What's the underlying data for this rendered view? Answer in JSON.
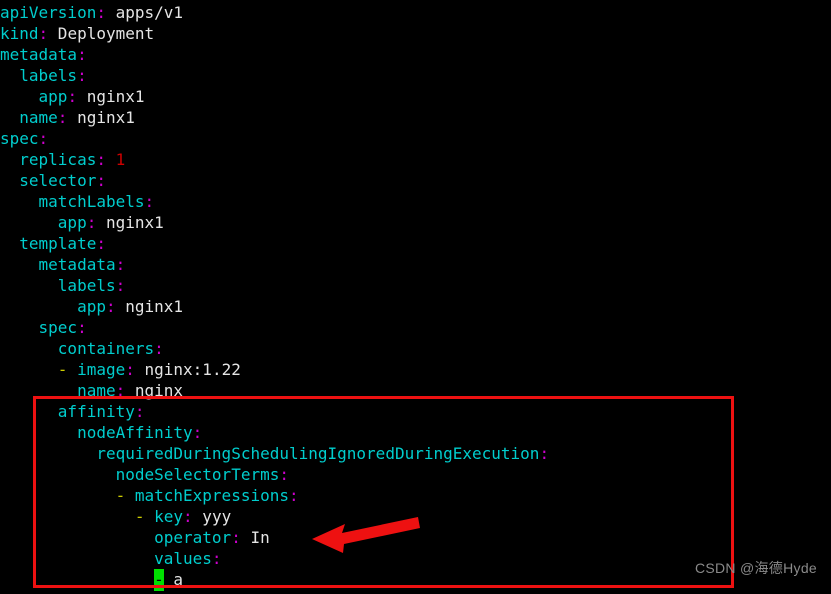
{
  "terminal": {
    "background_color": "#000000",
    "key_color": "#00cdcd",
    "colon_color": "#cd00cd",
    "value_color": "#e5e5e5",
    "number_color": "#cd0000",
    "dash_color": "#cdcd00",
    "cursor_color": "#00e000",
    "lines": [
      {
        "indent": "",
        "dash": "",
        "key": "apiVersion",
        "colon": ":",
        "value": " apps/v1",
        "value_type": "string"
      },
      {
        "indent": "",
        "dash": "",
        "key": "kind",
        "colon": ":",
        "value": " Deployment",
        "value_type": "string"
      },
      {
        "indent": "",
        "dash": "",
        "key": "metadata",
        "colon": ":",
        "value": "",
        "value_type": "none"
      },
      {
        "indent": "  ",
        "dash": "",
        "key": "labels",
        "colon": ":",
        "value": "",
        "value_type": "none"
      },
      {
        "indent": "    ",
        "dash": "",
        "key": "app",
        "colon": ":",
        "value": " nginx1",
        "value_type": "string"
      },
      {
        "indent": "  ",
        "dash": "",
        "key": "name",
        "colon": ":",
        "value": " nginx1",
        "value_type": "string"
      },
      {
        "indent": "",
        "dash": "",
        "key": "spec",
        "colon": ":",
        "value": "",
        "value_type": "none"
      },
      {
        "indent": "  ",
        "dash": "",
        "key": "replicas",
        "colon": ":",
        "value": " 1",
        "value_type": "number"
      },
      {
        "indent": "  ",
        "dash": "",
        "key": "selector",
        "colon": ":",
        "value": "",
        "value_type": "none"
      },
      {
        "indent": "    ",
        "dash": "",
        "key": "matchLabels",
        "colon": ":",
        "value": "",
        "value_type": "none"
      },
      {
        "indent": "      ",
        "dash": "",
        "key": "app",
        "colon": ":",
        "value": " nginx1",
        "value_type": "string"
      },
      {
        "indent": "  ",
        "dash": "",
        "key": "template",
        "colon": ":",
        "value": "",
        "value_type": "none"
      },
      {
        "indent": "    ",
        "dash": "",
        "key": "metadata",
        "colon": ":",
        "value": "",
        "value_type": "none"
      },
      {
        "indent": "      ",
        "dash": "",
        "key": "labels",
        "colon": ":",
        "value": "",
        "value_type": "none"
      },
      {
        "indent": "        ",
        "dash": "",
        "key": "app",
        "colon": ":",
        "value": " nginx1",
        "value_type": "string"
      },
      {
        "indent": "    ",
        "dash": "",
        "key": "spec",
        "colon": ":",
        "value": "",
        "value_type": "none"
      },
      {
        "indent": "      ",
        "dash": "",
        "key": "containers",
        "colon": ":",
        "value": "",
        "value_type": "none"
      },
      {
        "indent": "      ",
        "dash": "- ",
        "key": "image",
        "colon": ":",
        "value": " nginx:1.22",
        "value_type": "string"
      },
      {
        "indent": "        ",
        "dash": "",
        "key": "name",
        "colon": ":",
        "value": " nginx",
        "value_type": "string"
      },
      {
        "indent": "      ",
        "dash": "",
        "key": "affinity",
        "colon": ":",
        "value": "",
        "value_type": "none"
      },
      {
        "indent": "        ",
        "dash": "",
        "key": "nodeAffinity",
        "colon": ":",
        "value": "",
        "value_type": "none"
      },
      {
        "indent": "          ",
        "dash": "",
        "key": "requiredDuringSchedulingIgnoredDuringExecution",
        "colon": ":",
        "value": "",
        "value_type": "none"
      },
      {
        "indent": "            ",
        "dash": "",
        "key": "nodeSelectorTerms",
        "colon": ":",
        "value": "",
        "value_type": "none"
      },
      {
        "indent": "            ",
        "dash": "- ",
        "key": "matchExpressions",
        "colon": ":",
        "value": "",
        "value_type": "none"
      },
      {
        "indent": "              ",
        "dash": "- ",
        "key": "key",
        "colon": ":",
        "value": " yyy",
        "value_type": "string"
      },
      {
        "indent": "                ",
        "dash": "",
        "key": "operator",
        "colon": ":",
        "value": " In",
        "value_type": "string"
      },
      {
        "indent": "                ",
        "dash": "",
        "key": "values",
        "colon": ":",
        "value": "",
        "value_type": "none"
      },
      {
        "indent": "                ",
        "dash": "",
        "key": "",
        "colon": "",
        "value": "",
        "value_type": "cursor",
        "cursor_char": "-",
        "after_cursor": " a"
      }
    ]
  },
  "annotations": {
    "highlight_box": {
      "label": "affinity-block-highlight",
      "color": "#ee1111",
      "border_width": 3
    },
    "arrow": {
      "label": "operator-in-arrow",
      "color": "#ee1111",
      "direction": "left"
    }
  },
  "watermark": {
    "text": "CSDN @海德Hyde",
    "color": "#8a8a8a"
  }
}
